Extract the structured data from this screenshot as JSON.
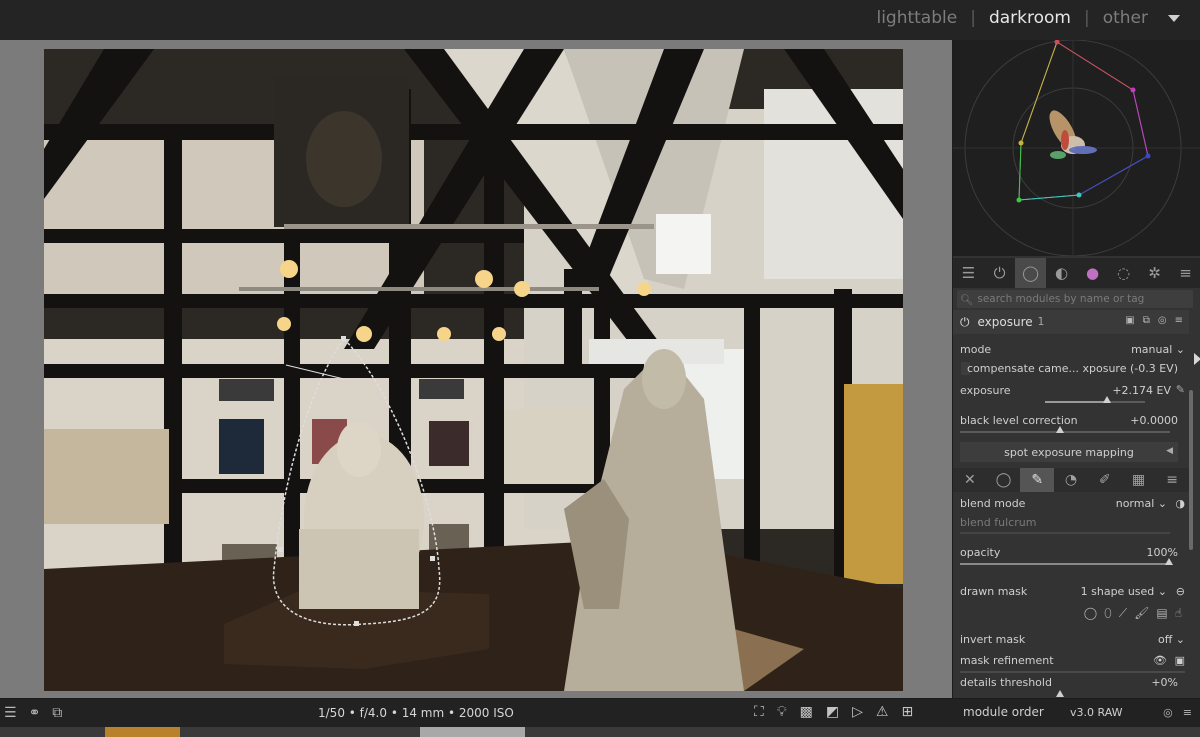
{
  "views": {
    "lighttable": "lighttable",
    "darkroom": "darkroom",
    "other": "other",
    "sep": "|"
  },
  "module_groups": [
    "quick-access-icon",
    "active-modules-icon",
    "base-group-icon",
    "tone-group-icon",
    "color-group-icon",
    "correct-group-icon",
    "effect-group-icon",
    "presets-menu-icon"
  ],
  "search": {
    "placeholder": "search modules by name or tag"
  },
  "module": {
    "name": "exposure",
    "instance": "1",
    "mode_label": "mode",
    "mode_value": "manual",
    "compensate_label": "compensate came... xposure (-0.3 EV)",
    "exposure_label": "exposure",
    "exposure_value": "+2.174 EV",
    "black_label": "black level correction",
    "black_value": "+0.0000",
    "spot_label": "spot exposure mapping"
  },
  "blend": {
    "mode_label": "blend mode",
    "mode_value": "normal",
    "fulcrum_label": "blend fulcrum",
    "opacity_label": "opacity",
    "opacity_value": "100%",
    "drawn_label": "drawn mask",
    "drawn_value": "1 shape used",
    "invert_label": "invert mask",
    "invert_value": "off",
    "refine_label": "mask refinement",
    "details_label": "details threshold",
    "details_value": "+0%"
  },
  "bottom": {
    "exif": "1/50 • f/4.0 • 14 mm • 2000 ISO",
    "module_order_label": "module order",
    "module_order_value": "v3.0 RAW"
  },
  "colors": {
    "accent_scope_red": "#d24c5c",
    "accent_scope_magenta": "#c33cc8",
    "accent_scope_blue": "#3c46c8",
    "accent_scope_green": "#3cc846",
    "accent_scope_yellow": "#c8b43c"
  }
}
